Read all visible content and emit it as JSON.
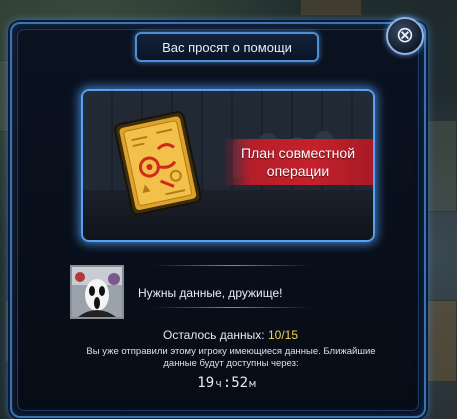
{
  "dialog": {
    "title": "Вас просят о помощи",
    "close_icon": "close-x-icon"
  },
  "item": {
    "name_line1": "План совместной",
    "name_line2": "операции",
    "icon": "operation-plan-tablet-icon"
  },
  "request": {
    "message": "Нужны данные, дружище!",
    "avatar": "player-avatar-mask"
  },
  "progress": {
    "label": "Осталось данных:",
    "count": "10/15",
    "count_color": "#f3d84a"
  },
  "notice": {
    "text": "Вы уже отправили этому игроку имеющиеся данные. Ближайшие данные будут доступны через:"
  },
  "timer": {
    "hours": "19",
    "hours_unit": "ч",
    "minutes": "52",
    "minutes_unit": "м"
  },
  "colors": {
    "frame": "#3a74b8",
    "banner": "#c4212c"
  }
}
